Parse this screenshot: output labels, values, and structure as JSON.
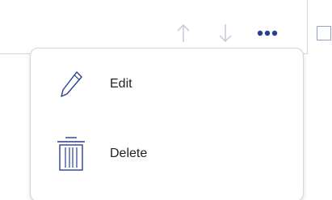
{
  "toolbar": {
    "icons": [
      "up-arrow-icon",
      "down-arrow-icon",
      "more-options-icon"
    ]
  },
  "menu": {
    "items": [
      {
        "label": "Edit",
        "icon": "pencil-icon"
      },
      {
        "label": "Delete",
        "icon": "trash-icon"
      }
    ]
  },
  "colors": {
    "icon_faded": "#c3c8d6",
    "accent": "#2a3f8f",
    "border": "#cfd6e2",
    "text": "#222222"
  }
}
